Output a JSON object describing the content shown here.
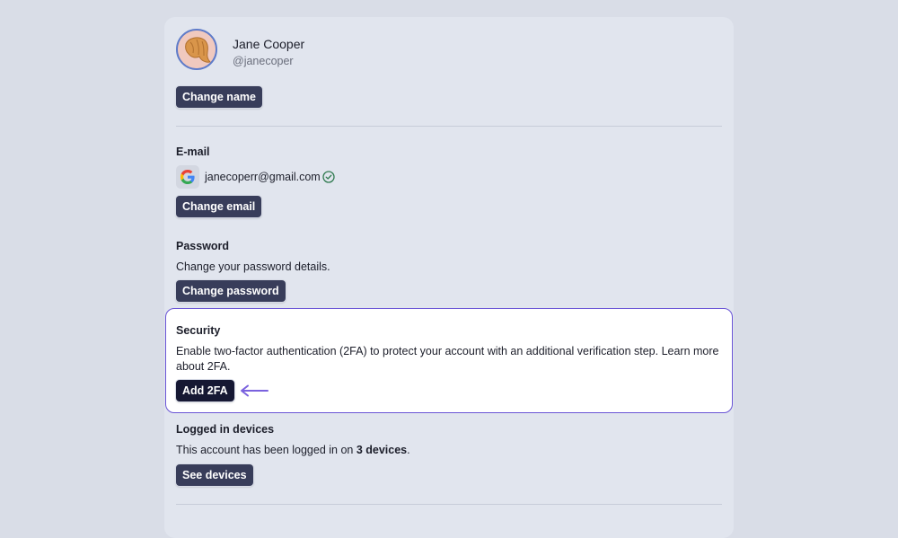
{
  "profile": {
    "name": "Jane Cooper",
    "handle": "@janecoper",
    "change_name_label": "Change name"
  },
  "email": {
    "title": "E-mail",
    "address": "janecoperr@gmail.com",
    "provider_icon": "google-icon",
    "verified_icon": "check-circle-icon",
    "change_email_label": "Change email"
  },
  "password": {
    "title": "Password",
    "description": "Change your password details.",
    "change_password_label": "Change password"
  },
  "security": {
    "title": "Security",
    "description": "Enable two-factor authentication (2FA) to protect your account with an additional verification step. Learn more about 2FA.",
    "add_2fa_label": "Add 2FA",
    "highlight_color": "#6a55d6"
  },
  "devices": {
    "title": "Logged in devices",
    "description_prefix": "This account has been logged in on ",
    "device_count_text": "3 devices",
    "description_suffix": ".",
    "see_devices_label": "See devices"
  },
  "colors": {
    "background": "#d9dde7",
    "card": "#e1e5ee",
    "button": "#383d5a",
    "button_dark": "#161833",
    "accent_arrow": "#7a62de"
  }
}
